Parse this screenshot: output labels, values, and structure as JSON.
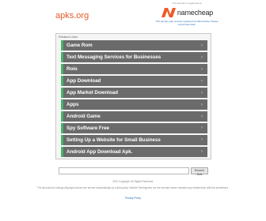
{
  "header": {
    "domain": "apks.org"
  },
  "promo": {
    "owner_line": "This domain is registered at",
    "brand": "namecheap",
    "tagline": "This domain was recently registered at Namecheap. Please check back later!"
  },
  "panel": {
    "title": "Related Links",
    "items": [
      {
        "label": "Game Rom"
      },
      {
        "label": "Text Messaging Services for Businesses"
      },
      {
        "label": "Roio"
      },
      {
        "label": "App Download"
      },
      {
        "label": "App Market Download"
      },
      {
        "label": "Apps"
      },
      {
        "label": "Android Game"
      },
      {
        "label": "Spy Software Free"
      },
      {
        "label": "Setting Up a Website for Small Business"
      },
      {
        "label": "Android App Download Apk."
      }
    ]
  },
  "search": {
    "placeholder": "",
    "button_label": "Search Ads"
  },
  "footer": {
    "copyright": "2022 Copyright. All Rights Reserved.",
    "disclaimer": "The Sponsored Listings displayed above are served automatically by a third party. Neither Parkingcrew nor the domain owner maintain any relationship with the advertisers.",
    "privacy": "Privacy Policy"
  },
  "colors": {
    "domain": "#e35a2a",
    "item_bg": "#6b6b6b",
    "item_accent": "#49b36c",
    "brand_orange": "#ef5a28"
  }
}
